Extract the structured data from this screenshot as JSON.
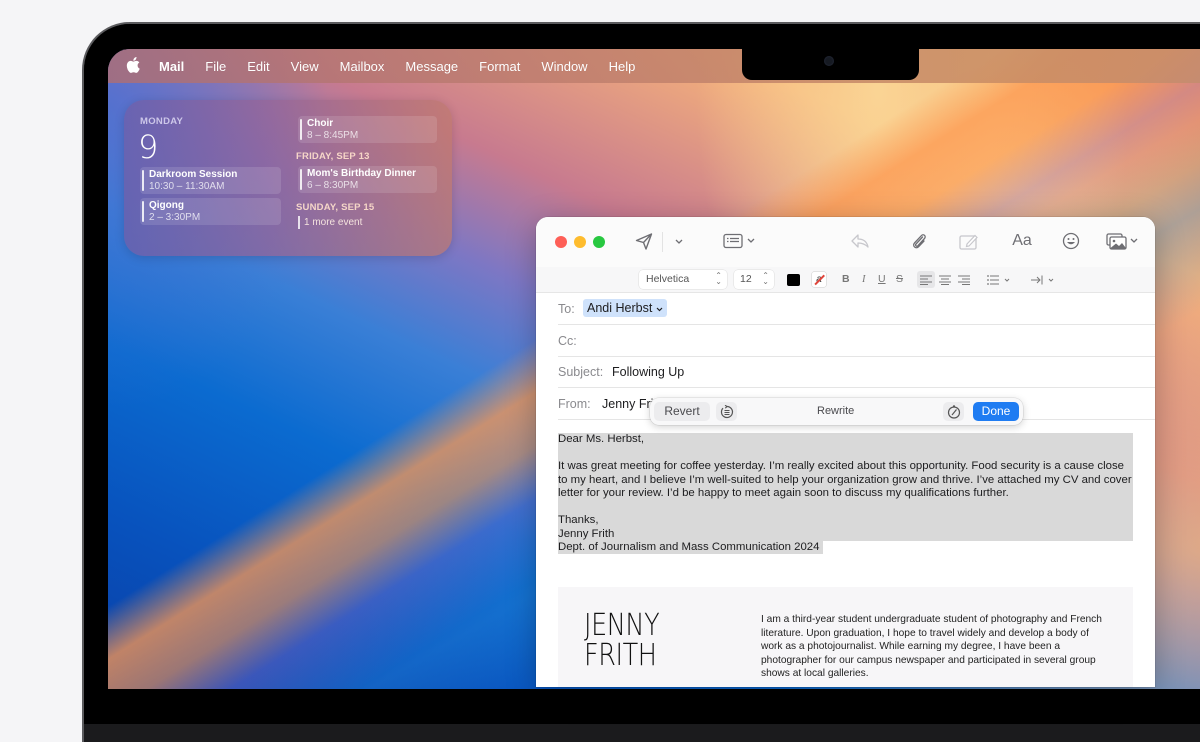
{
  "menubar": {
    "apple_icon": "apple-logo-icon",
    "items": [
      "Mail",
      "File",
      "Edit",
      "View",
      "Mailbox",
      "Message",
      "Format",
      "Window",
      "Help"
    ]
  },
  "calendar_widget": {
    "day_name": "MONDAY",
    "date": "9",
    "today_events": [
      {
        "title": "Darkroom Session",
        "time": "10:30 – 11:30AM"
      },
      {
        "title": "Qigong",
        "time": "2 – 3:30PM"
      }
    ],
    "upcoming": [
      {
        "title": "Choir",
        "time": "8 – 8:45PM"
      }
    ],
    "friday_header": "FRIDAY, SEP 13",
    "friday_events": [
      {
        "title": "Mom's Birthday Dinner",
        "time": "6 – 8:30PM"
      }
    ],
    "sunday_header": "SUNDAY, SEP 15",
    "more_label": "1 more event"
  },
  "mail_window": {
    "toolbar": {
      "icons": [
        "send-icon",
        "send-options-chevron-icon",
        "header-fields-icon",
        "reply-icon",
        "attachment-icon",
        "markup-icon",
        "font-format-icon",
        "emoji-icon",
        "photo-browser-icon"
      ],
      "format_label": "Aa"
    },
    "format_bar": {
      "font": "Helvetica",
      "size": "12",
      "text_color": "#000000",
      "bold": "B",
      "italic": "I",
      "underline": "U",
      "strikethrough": "S"
    },
    "fields": {
      "to_label": "To:",
      "to_value": "Andi Herbst",
      "cc_label": "Cc:",
      "cc_value": "",
      "subject_label": "Subject:",
      "subject_value": "Following Up",
      "from_label": "From:",
      "from_value": "Jenny Frith"
    },
    "rewrite_bar": {
      "revert_label": "Revert",
      "title": "Rewrite",
      "done_label": "Done",
      "accent": "#1f7cf2"
    },
    "body": {
      "greeting": "Dear Ms. Herbst,",
      "paragraph": "It was great meeting for coffee yesterday. I’m really excited about this opportunity. Food security is a cause close to my heart, and I believe I’m well-suited to help your organization grow and thrive. I’ve attached my CV and cover letter for your review. I’d be happy to meet again soon to discuss my qualifications further.",
      "signoff": "Thanks,",
      "name": "Jenny Frith",
      "dept": "Dept. of Journalism and Mass Communication 2024"
    },
    "attachment": {
      "name_line1": "JENNY",
      "name_line2": "FRITH",
      "bio": "I am a third-year student undergraduate student of photography and French literature. Upon graduation, I hope to travel widely and develop a body of work as a photojournalist. While earning my degree, I have been a photographer for our campus newspaper and participated in several group shows at local galleries."
    }
  }
}
